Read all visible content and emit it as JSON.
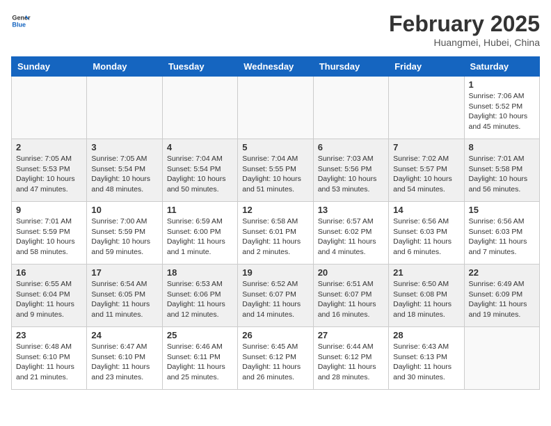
{
  "logo": {
    "line1": "General",
    "line2": "Blue"
  },
  "title": "February 2025",
  "location": "Huangmei, Hubei, China",
  "days_of_week": [
    "Sunday",
    "Monday",
    "Tuesday",
    "Wednesday",
    "Thursday",
    "Friday",
    "Saturday"
  ],
  "weeks": [
    {
      "alt": false,
      "days": [
        {
          "num": "",
          "info": ""
        },
        {
          "num": "",
          "info": ""
        },
        {
          "num": "",
          "info": ""
        },
        {
          "num": "",
          "info": ""
        },
        {
          "num": "",
          "info": ""
        },
        {
          "num": "",
          "info": ""
        },
        {
          "num": "1",
          "info": "Sunrise: 7:06 AM\nSunset: 5:52 PM\nDaylight: 10 hours and 45 minutes."
        }
      ]
    },
    {
      "alt": true,
      "days": [
        {
          "num": "2",
          "info": "Sunrise: 7:05 AM\nSunset: 5:53 PM\nDaylight: 10 hours and 47 minutes."
        },
        {
          "num": "3",
          "info": "Sunrise: 7:05 AM\nSunset: 5:54 PM\nDaylight: 10 hours and 48 minutes."
        },
        {
          "num": "4",
          "info": "Sunrise: 7:04 AM\nSunset: 5:54 PM\nDaylight: 10 hours and 50 minutes."
        },
        {
          "num": "5",
          "info": "Sunrise: 7:04 AM\nSunset: 5:55 PM\nDaylight: 10 hours and 51 minutes."
        },
        {
          "num": "6",
          "info": "Sunrise: 7:03 AM\nSunset: 5:56 PM\nDaylight: 10 hours and 53 minutes."
        },
        {
          "num": "7",
          "info": "Sunrise: 7:02 AM\nSunset: 5:57 PM\nDaylight: 10 hours and 54 minutes."
        },
        {
          "num": "8",
          "info": "Sunrise: 7:01 AM\nSunset: 5:58 PM\nDaylight: 10 hours and 56 minutes."
        }
      ]
    },
    {
      "alt": false,
      "days": [
        {
          "num": "9",
          "info": "Sunrise: 7:01 AM\nSunset: 5:59 PM\nDaylight: 10 hours and 58 minutes."
        },
        {
          "num": "10",
          "info": "Sunrise: 7:00 AM\nSunset: 5:59 PM\nDaylight: 10 hours and 59 minutes."
        },
        {
          "num": "11",
          "info": "Sunrise: 6:59 AM\nSunset: 6:00 PM\nDaylight: 11 hours and 1 minute."
        },
        {
          "num": "12",
          "info": "Sunrise: 6:58 AM\nSunset: 6:01 PM\nDaylight: 11 hours and 2 minutes."
        },
        {
          "num": "13",
          "info": "Sunrise: 6:57 AM\nSunset: 6:02 PM\nDaylight: 11 hours and 4 minutes."
        },
        {
          "num": "14",
          "info": "Sunrise: 6:56 AM\nSunset: 6:03 PM\nDaylight: 11 hours and 6 minutes."
        },
        {
          "num": "15",
          "info": "Sunrise: 6:56 AM\nSunset: 6:03 PM\nDaylight: 11 hours and 7 minutes."
        }
      ]
    },
    {
      "alt": true,
      "days": [
        {
          "num": "16",
          "info": "Sunrise: 6:55 AM\nSunset: 6:04 PM\nDaylight: 11 hours and 9 minutes."
        },
        {
          "num": "17",
          "info": "Sunrise: 6:54 AM\nSunset: 6:05 PM\nDaylight: 11 hours and 11 minutes."
        },
        {
          "num": "18",
          "info": "Sunrise: 6:53 AM\nSunset: 6:06 PM\nDaylight: 11 hours and 12 minutes."
        },
        {
          "num": "19",
          "info": "Sunrise: 6:52 AM\nSunset: 6:07 PM\nDaylight: 11 hours and 14 minutes."
        },
        {
          "num": "20",
          "info": "Sunrise: 6:51 AM\nSunset: 6:07 PM\nDaylight: 11 hours and 16 minutes."
        },
        {
          "num": "21",
          "info": "Sunrise: 6:50 AM\nSunset: 6:08 PM\nDaylight: 11 hours and 18 minutes."
        },
        {
          "num": "22",
          "info": "Sunrise: 6:49 AM\nSunset: 6:09 PM\nDaylight: 11 hours and 19 minutes."
        }
      ]
    },
    {
      "alt": false,
      "days": [
        {
          "num": "23",
          "info": "Sunrise: 6:48 AM\nSunset: 6:10 PM\nDaylight: 11 hours and 21 minutes."
        },
        {
          "num": "24",
          "info": "Sunrise: 6:47 AM\nSunset: 6:10 PM\nDaylight: 11 hours and 23 minutes."
        },
        {
          "num": "25",
          "info": "Sunrise: 6:46 AM\nSunset: 6:11 PM\nDaylight: 11 hours and 25 minutes."
        },
        {
          "num": "26",
          "info": "Sunrise: 6:45 AM\nSunset: 6:12 PM\nDaylight: 11 hours and 26 minutes."
        },
        {
          "num": "27",
          "info": "Sunrise: 6:44 AM\nSunset: 6:12 PM\nDaylight: 11 hours and 28 minutes."
        },
        {
          "num": "28",
          "info": "Sunrise: 6:43 AM\nSunset: 6:13 PM\nDaylight: 11 hours and 30 minutes."
        },
        {
          "num": "",
          "info": ""
        }
      ]
    }
  ]
}
